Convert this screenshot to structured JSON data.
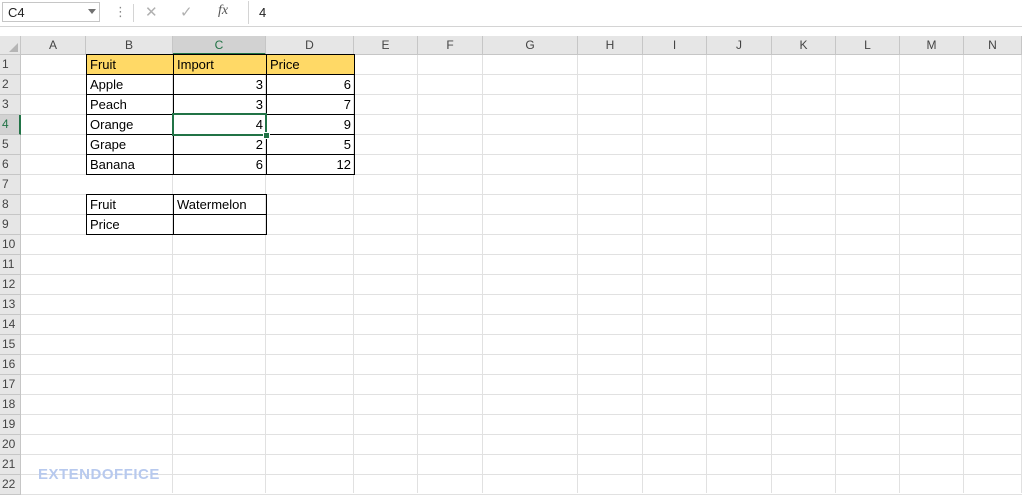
{
  "formula_bar": {
    "name_box": "C4",
    "dots": "⋮",
    "cancel_icon": "✕",
    "enter_icon": "✓",
    "fx_label": "fx",
    "formula_value": "4"
  },
  "columns": [
    "A",
    "B",
    "C",
    "D",
    "E",
    "F",
    "G",
    "H",
    "I",
    "J",
    "K",
    "L",
    "M",
    "N"
  ],
  "rows": [
    "1",
    "2",
    "3",
    "4",
    "5",
    "6",
    "7",
    "8",
    "9",
    "10",
    "11",
    "12",
    "13",
    "14",
    "15",
    "16",
    "17",
    "18",
    "19",
    "20",
    "21",
    "22"
  ],
  "selected_cell": "C4",
  "table": {
    "headers": [
      "Fruit",
      "Import",
      "Price"
    ],
    "rows": [
      [
        "Apple",
        "3",
        "6"
      ],
      [
        "Peach",
        "3",
        "7"
      ],
      [
        "Orange",
        "4",
        "9"
      ],
      [
        "Grape",
        "2",
        "5"
      ],
      [
        "Banana",
        "6",
        "12"
      ]
    ]
  },
  "lookup": {
    "fruit_label": "Fruit",
    "fruit_value": "Watermelon",
    "price_label": "Price",
    "price_value": ""
  },
  "watermark": "EXTENDOFFICE",
  "colors": {
    "header_fill": "#ffd966",
    "selection_accent": "#217346"
  }
}
